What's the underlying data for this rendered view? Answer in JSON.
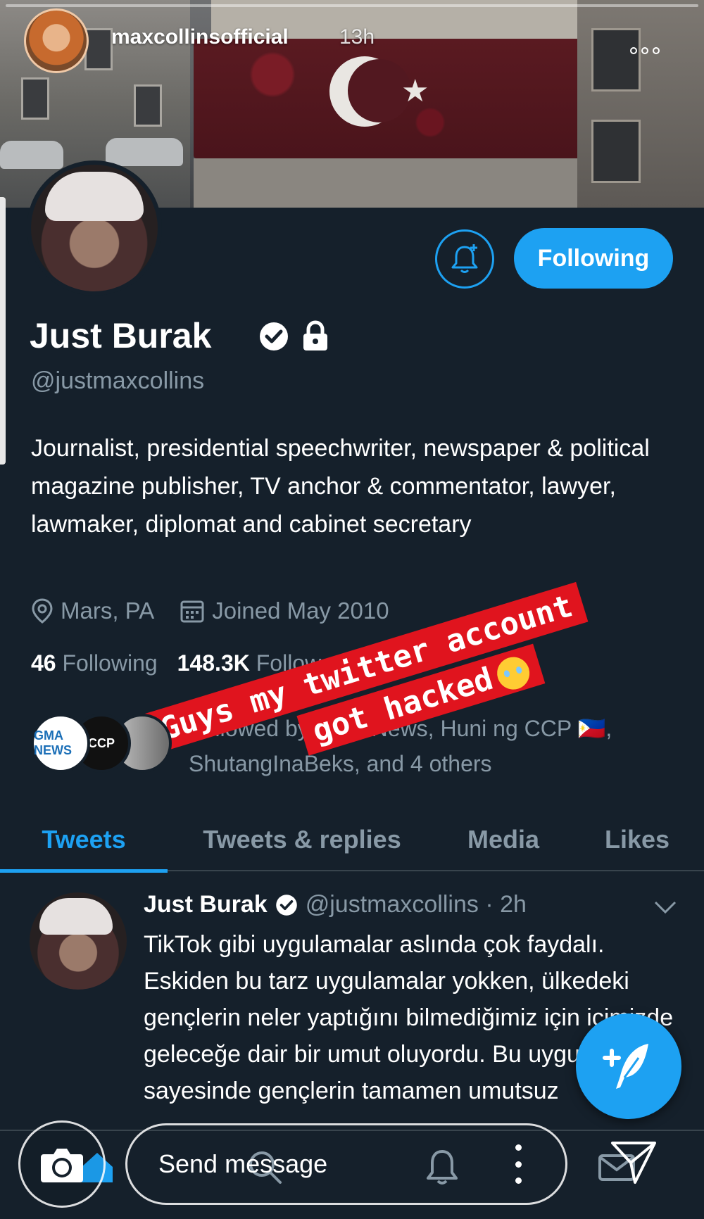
{
  "story": {
    "username": "maxcollinsofficial",
    "time": "13h"
  },
  "profile": {
    "follow_label": "Following",
    "name": "Just Burak",
    "handle": "@justmaxcollins",
    "bio": "Journalist, presidential speechwriter, newspaper & political magazine publisher, TV anchor & commentator, lawyer, lawmaker, diplomat and cabinet secretary",
    "location": "Mars, PA",
    "joined": "Joined May 2010",
    "following_count": "46",
    "following_label": "Following",
    "followers_count": "148.3K",
    "followers_label": "Followers",
    "followed_by_text": "Followed by GMA News, Huni ng CCP 🇵🇭, ShutangInaBeks, and 4 others",
    "follower_avatars": [
      "GMA NEWS",
      "CCP",
      ""
    ]
  },
  "sticker": {
    "line1": "Guys my twitter account",
    "line2": "got hacked"
  },
  "tabs": [
    "Tweets",
    "Tweets & replies",
    "Media",
    "Likes"
  ],
  "tweet": {
    "name": "Just Burak",
    "handle_time": "@justmaxcollins · 2h",
    "text": "TikTok gibi uygulamalar aslında çok faydalı. Eskiden bu tarz uygulamalar yokken, ülkedeki gençlerin neler yaptığını bilmediğimiz için içimizde geleceğe dair bir umut oluyordu. Bu uygulamalar sayesinde gençlerin tamamen umutsuz"
  },
  "reply_bar": {
    "placeholder": "Send message"
  },
  "colors": {
    "background": "#15202b",
    "accent": "#1da1f2",
    "secondary_text": "#8899a6",
    "sticker_red": "#e0141e"
  },
  "icons": [
    "more-dots-icon",
    "bell-plus-icon",
    "verified-badge-icon",
    "lock-icon",
    "location-pin-icon",
    "calendar-icon",
    "chevron-down-icon",
    "compose-feather-icon",
    "search-icon",
    "notifications-icon",
    "messages-icon",
    "camera-icon",
    "send-icon"
  ]
}
